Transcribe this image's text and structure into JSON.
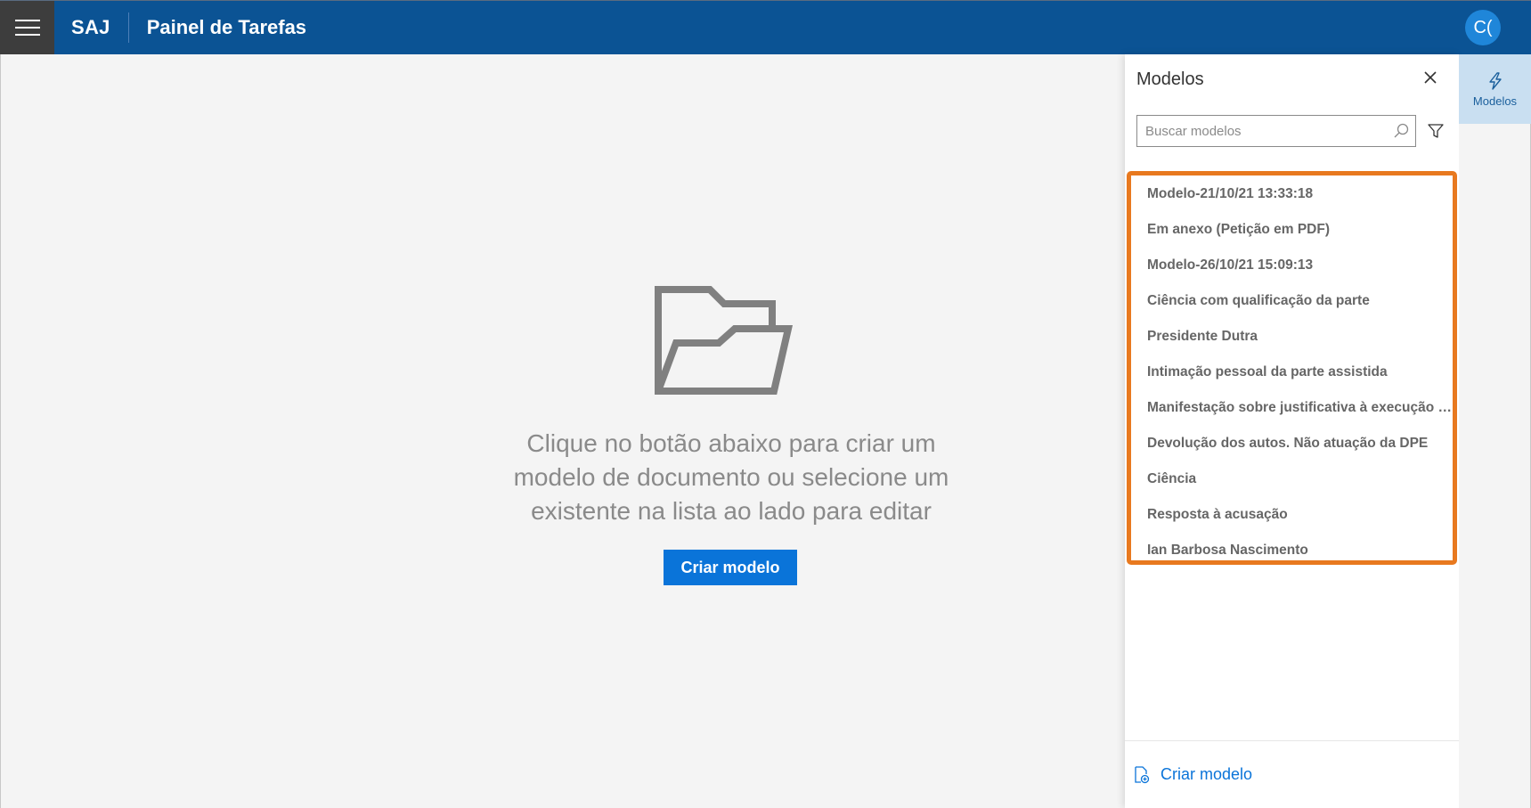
{
  "header": {
    "brand": "SAJ",
    "title": "Painel de Tarefas",
    "avatar_initials": "C("
  },
  "main": {
    "empty_text": "Clique no botão abaixo para criar um modelo de documento ou selecione um existente na lista ao lado para editar",
    "create_button": "Criar modelo"
  },
  "panel": {
    "title": "Modelos",
    "search_placeholder": "Buscar modelos",
    "items": [
      "Modelo-21/10/21 13:33:18",
      "Em anexo (Petição em PDF)",
      "Modelo-26/10/21 15:09:13",
      "Ciência com qualificação da parte",
      "Presidente Dutra",
      "Intimação pessoal da parte assistida",
      "Manifestação sobre justificativa à execução de ali...",
      "Devolução dos autos. Não atuação da DPE",
      "Ciência",
      "Resposta à acusação",
      "Ian Barbosa Nascimento"
    ],
    "footer_label": "Criar modelo"
  },
  "rail": {
    "tab_label": "Modelos"
  },
  "colors": {
    "header": "#0b5394",
    "accent": "#0a74d9",
    "highlight": "#e8791f"
  }
}
